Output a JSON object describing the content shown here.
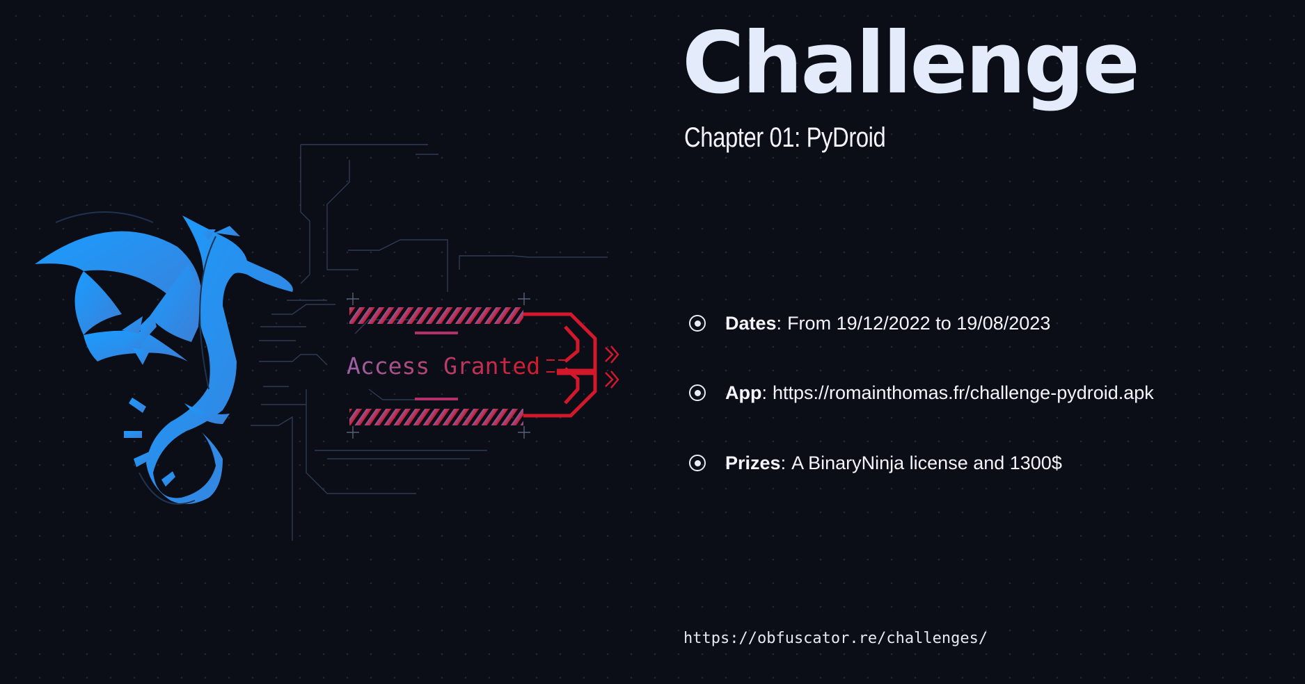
{
  "title": "Challenge",
  "subtitle": "Chapter 01: PyDroid",
  "artwork": {
    "status_text": "Access Granted",
    "logo": "dragon-logo"
  },
  "details": [
    {
      "key": "Dates",
      "sep": ":",
      "value": "From 19/12/2022 to 19/08/2023",
      "icon": "bullet-icon"
    },
    {
      "key": "App",
      "sep": ":",
      "value": "https://romainthomas.fr/challenge-pydroid.apk",
      "icon": "bullet-icon"
    },
    {
      "key": "Prizes",
      "sep": ":",
      "value": "A BinaryNinja license and 1300$",
      "icon": "bullet-icon"
    }
  ],
  "footer_url": "https://obfuscator.re/challenges/",
  "colors": {
    "background": "#0b0e16",
    "title": "#e4ecfb",
    "dragon": "#2a8ce8",
    "accent_red": "#d4182c",
    "accent_purple": "#8c5a9a"
  }
}
